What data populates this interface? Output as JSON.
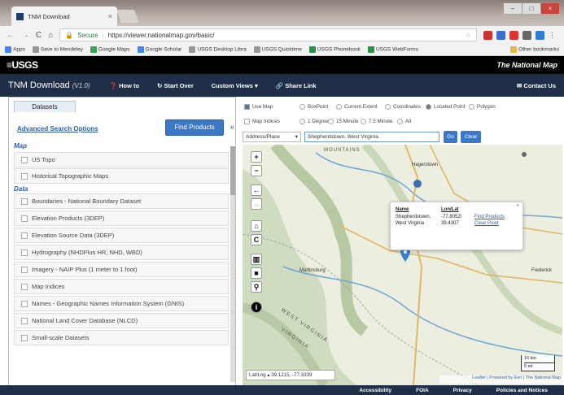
{
  "browser": {
    "tab_title": "TNM Download",
    "secure_label": "Secure",
    "url": "https://viewer.nationalmap.gov/basic/",
    "bookmarks": [
      "Apps",
      "Save to Mendeley",
      "Google Maps",
      "Google Scholar",
      "USGS Desktop Libra",
      "USGS Quicktime",
      "USGS Phonebook",
      "USGS WebForms",
      "Other bookmarks"
    ]
  },
  "header": {
    "logo": "≡USGS",
    "brand": "The National Map"
  },
  "nav": {
    "title": "TNM Download",
    "version": "(V1.0)",
    "items": [
      "How to",
      "Start Over",
      "Custom Views ▾",
      "Share Link"
    ],
    "contact": "Contact Us"
  },
  "left": {
    "tab": "Datasets",
    "advanced": "Advanced Search Options",
    "find_button": "Find Products",
    "section_map": "Map",
    "map_items": [
      "US Topo",
      "Historical Topographic Maps"
    ],
    "section_data": "Data",
    "data_items": [
      "Boundaries - National Boundary Dataset",
      "Elevation Products (3DEP)",
      "Elevation Source Data (3DEP)",
      "Hydrography (NHDPlus HR, NHD, WBD)",
      "Imagery - NAIP Plus (1 meter to 1 foot)",
      "Map Indices",
      "Names - Geographic Names Information System (GNIS)",
      "National Land Cover Database (NLCD)",
      "Small-scale Datasets"
    ]
  },
  "controls": {
    "use_map": "Use Map",
    "extent_options": [
      "BoxPoint",
      "Current Extent",
      "Coordinates",
      "Located Point",
      "Polygon"
    ],
    "map_indices": "Map Indices",
    "grid_options": [
      "1 Degree",
      "15 Minute",
      "7.5 Minute",
      "All"
    ],
    "address_select": "Address/Place",
    "address_value": "Shepherdstown, West Virginia",
    "go": "Go",
    "clear": "Clear"
  },
  "popup": {
    "name_header": "Name",
    "lonlat_header": "Lon/Lat",
    "name1": "Shepherdstown,",
    "name2": "West Virginia",
    "lon": "-77.8052/",
    "lat": "39.4307",
    "find_products": "Find Products",
    "clear_point": "Clear Point"
  },
  "map": {
    "labels": [
      "MOUNTAINS",
      "Hagerstown",
      "Martinsburg",
      "Frederick",
      "WEST VIRGINIA",
      "VIRGINIA"
    ],
    "coords": "Lat/Lng ▴   39.1215, -77.3339",
    "scale_km": "10 km",
    "scale_mi": "5 mi",
    "attribution": "Leaflet | Powered by Esri | The National Map"
  },
  "footer": [
    "Accessibility",
    "FOIA",
    "Privacy",
    "Policies and Notices"
  ]
}
